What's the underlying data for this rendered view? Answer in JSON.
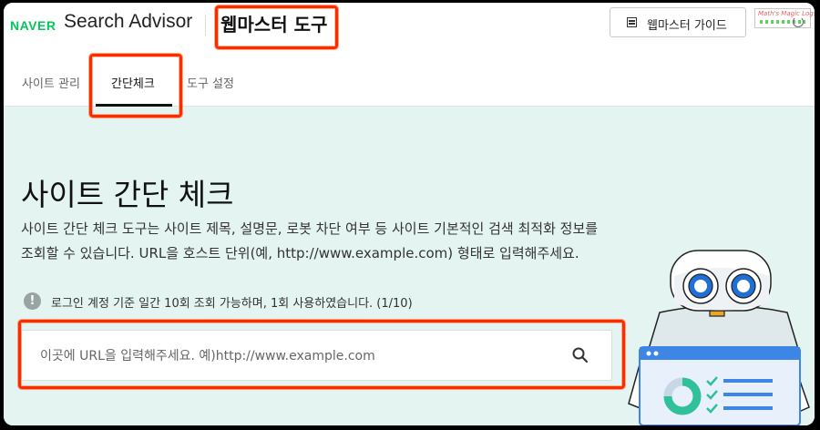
{
  "header": {
    "naver_logo": "NAVER",
    "app_name": "Search Advisor",
    "section_title": "웹마스터 도구",
    "guide_button": "웹마스터 가이드",
    "mini_logo_text": "Math's Magic Logs"
  },
  "tabs": [
    {
      "label": "사이트 관리",
      "active": false
    },
    {
      "label": "간단체크",
      "active": true
    },
    {
      "label": "도구 설정",
      "active": false
    }
  ],
  "main": {
    "title": "사이트 간단 체크",
    "description_line1": "사이트 간단 체크 도구는 사이트 제목, 설명문, 로봇 차단 여부 등 사이트 기본적인 검색 최적화 정보를",
    "description_line2": "조회할 수 있습니다. URL을 호스트 단위(예, http://www.example.com) 형태로 입력해주세요.",
    "notice": "로그인 계정 기준 일간 10회 조회 가능하며, 1회 사용하였습니다. (1/10)",
    "notice_icon": "!",
    "search": {
      "placeholder": "이곳에 URL을 입력해주세요. 예)http://www.example.com",
      "value": ""
    }
  },
  "icons": {
    "guide": "list-document-icon",
    "search": "magnifier-icon",
    "notice": "exclamation-circle-icon",
    "refresh": "refresh-icon"
  },
  "colors": {
    "naver_green": "#03c75a",
    "content_bg": "#e3f4f1",
    "annotation_red": "#ff2a00",
    "active_tab": "#111111"
  }
}
